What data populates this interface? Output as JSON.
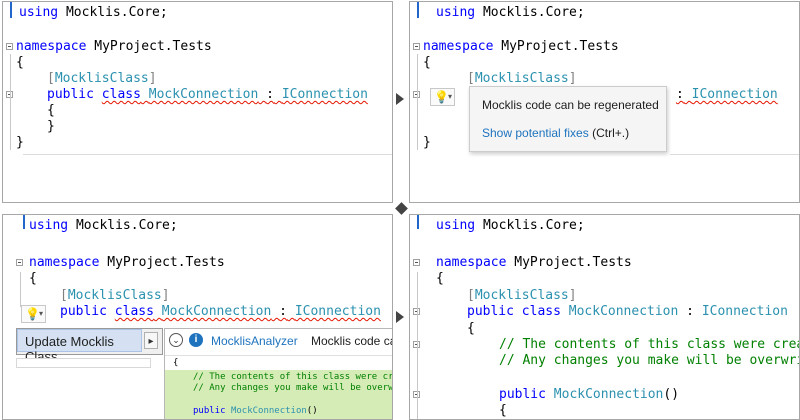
{
  "before_code": {
    "using_kw": "using",
    "using_ns": "Mocklis.Core;",
    "namespace_kw": "namespace",
    "namespace_name": "MyProject.Tests",
    "open_brace": "{",
    "close_brace": "}",
    "attr_open": "[",
    "attr_name": "MocklisClass",
    "attr_close": "]",
    "public_kw": "public",
    "class_kw": "class",
    "class_name": "MockConnection",
    "colon": ":",
    "interface_name": "IConnection"
  },
  "quick_info": {
    "message": "Mocklis code can be regenerated",
    "link": "Show potential fixes",
    "shortcut": "(Ctrl+.)"
  },
  "lightbulb": {
    "icon": "lightbulb-icon",
    "dropdown": "▾"
  },
  "actions_menu": {
    "item": "Update Mocklis Class",
    "submenu_arrow": "▸"
  },
  "preview": {
    "expand_icon": "⌄",
    "info_icon": "i",
    "analyzer": "MocklisAnalyzer",
    "message": "Mocklis code can",
    "line_brace": "{",
    "line_comment1": "// The contents of this class were cre",
    "line_comment2": "// Any changes you make will be overwr",
    "line_ctor_kw": "public",
    "line_ctor_name": "MockConnection",
    "line_ctor_parens": "()"
  },
  "after_code": {
    "comment1": "// The contents of this class were created",
    "comment2": "// Any changes you make will be overwritt",
    "ctor_public": "public",
    "ctor_name": "MockConnection",
    "ctor_parens": "()",
    "ctor_open": "{"
  },
  "colors": {
    "keyword": "#0000ff",
    "type": "#2b91af",
    "comment": "#008000",
    "squiggle": "#e51400",
    "link": "#1e73be",
    "preview_added_bg": "#d6ecb6"
  }
}
